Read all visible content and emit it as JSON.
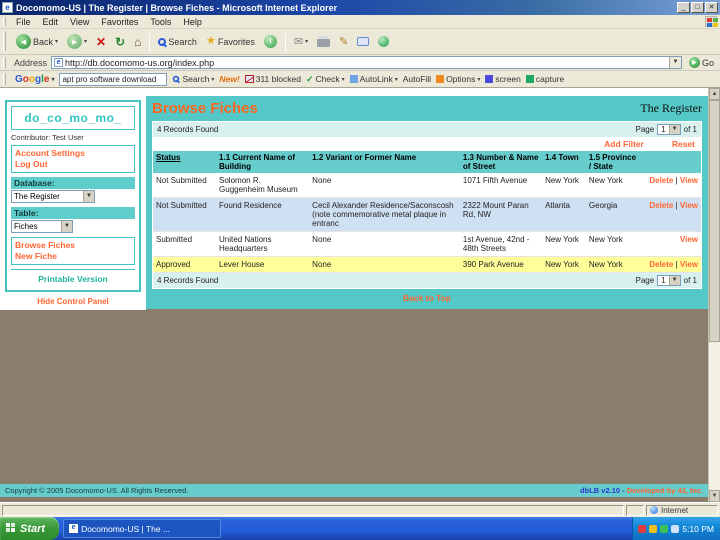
{
  "window": {
    "title": "Docomomo-US | The Register | Browse Fiches - Microsoft Internet Explorer",
    "menu_items": [
      "File",
      "Edit",
      "View",
      "Favorites",
      "Tools",
      "Help"
    ]
  },
  "toolbar": {
    "back_label": "Back",
    "search_label": "Search",
    "favorites_label": "Favorites"
  },
  "address_bar": {
    "label": "Address",
    "url": "http://db.docomomo-us.org/index.php",
    "go_label": "Go"
  },
  "google_bar": {
    "brand": "Google",
    "search_value": "apt pro software download",
    "search_button": "Search",
    "new_badge": "New!",
    "blocked_label": "311 blocked",
    "check_label": "Check",
    "autolink_label": "AutoLink",
    "autofill_label": "AutoFill",
    "options_label": "Options",
    "screen_label": "screen",
    "capture_label": "capture"
  },
  "sidebar": {
    "logo": "do_co_mo_mo_",
    "contributor": "Contributor: Test User",
    "account_settings": "Account Settings",
    "log_out": "Log Out",
    "database_label": "Database:",
    "database_value": "The Register",
    "table_label": "Table:",
    "table_value": "Fiches",
    "browse_fiches": "Browse Fiches",
    "new_fiche": "New Fiche",
    "printable_version": "Printable Version",
    "hide_control_panel": "Hide Control Panel"
  },
  "main": {
    "title": "Browse Fiches",
    "register_label": "The Register",
    "records_found": "4 Records Found",
    "page_label": "Page",
    "page_value": "1",
    "page_suffix": "of 1",
    "add_filter": "Add Filter",
    "reset": "Reset",
    "back_to_top": "Back to Top",
    "table": {
      "headers": [
        "Status",
        "1.1 Current Name of Building",
        "1.2 Variant or Former Name",
        "1.3 Number & Name of Street",
        "1.4 Town",
        "1.5 Province / State",
        ""
      ],
      "rows": [
        {
          "status": "Not Submitted",
          "name": "Solomon R. Guggenheim Museum",
          "variant": "None",
          "street": "1071 Fifth Avenue",
          "town": "New York",
          "state": "New York",
          "actions": [
            "Delete",
            "View"
          ],
          "highlight": "none"
        },
        {
          "status": "Not Submitted",
          "name": "Found Residence",
          "variant": "Cecil Alexander Residence/Saconscosh (note commemorative metal plaque in entranc",
          "street": "2322 Mount Paran Rd, NW",
          "town": "Atlanta",
          "state": "Georgia",
          "actions": [
            "Delete",
            "View"
          ],
          "highlight": "blue"
        },
        {
          "status": "Submitted",
          "name": "United Nations Headquarters",
          "variant": "None",
          "street": "1st Avenue, 42nd - 48th Streets",
          "town": "New York",
          "state": "New York",
          "actions": [
            "View"
          ],
          "highlight": "none"
        },
        {
          "status": "Approved",
          "name": "Lever House",
          "variant": "None",
          "street": "390 Park Avenue",
          "town": "New York",
          "state": "New York",
          "actions": [
            "Delete",
            "View"
          ],
          "highlight": "yellow"
        }
      ]
    }
  },
  "footer": {
    "copyright": "Copyright © 2005 Docomomo-US. All Rights Reserved.",
    "version_left": "dbLB v2.10 -",
    "version_right": "Developed by 42, Inc."
  },
  "status_bar": {
    "zone": "Internet"
  },
  "taskbar": {
    "start_label": "Start",
    "task_label": "Docomomo-US | The ...",
    "time": "5:10 PM"
  },
  "colors": {
    "accent_teal": "#54c8c6",
    "accent_orange": "#ff6633",
    "row_highlight_yellow": "#ffff99",
    "row_highlight_blue": "#cfe0f2",
    "page_background": "#8b7d6d"
  }
}
